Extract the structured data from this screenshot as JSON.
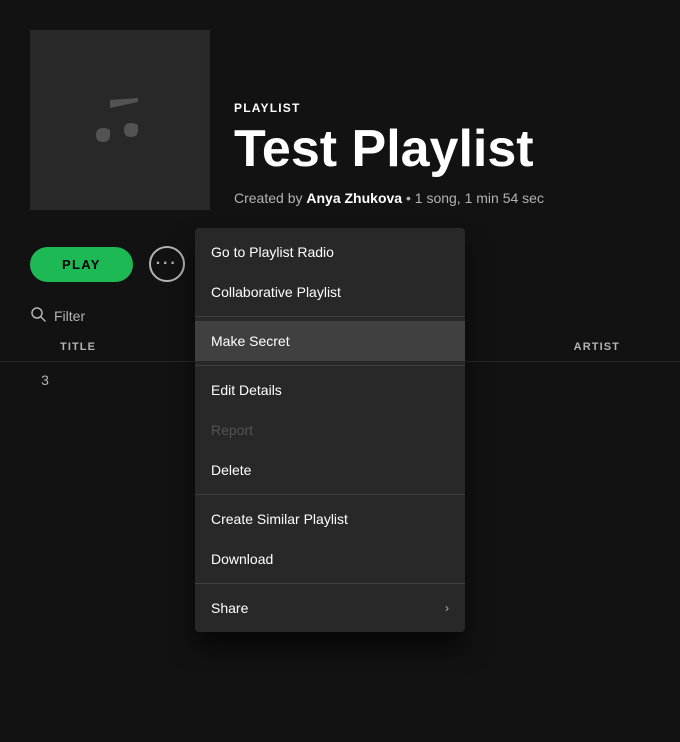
{
  "header": {
    "type_label": "PLAYLIST",
    "title": "Test Playlist",
    "creator": "Anya Zhukova",
    "meta": "1 song, 1 min 54 sec"
  },
  "controls": {
    "play_label": "PLAY",
    "more_dots": "•••"
  },
  "filter": {
    "placeholder": "Filter"
  },
  "table": {
    "col_title": "TITLE",
    "col_artist": "ARTIST",
    "rows": [
      {
        "number": "3"
      }
    ]
  },
  "context_menu": {
    "items": [
      {
        "id": "go-to-radio",
        "label": "Go to Playlist Radio",
        "highlighted": false,
        "disabled": false,
        "has_arrow": false
      },
      {
        "id": "collaborative-playlist",
        "label": "Collaborative Playlist",
        "highlighted": false,
        "disabled": false,
        "has_arrow": false
      },
      {
        "id": "make-secret",
        "label": "Make Secret",
        "highlighted": true,
        "disabled": false,
        "has_arrow": false
      },
      {
        "id": "edit-details",
        "label": "Edit Details",
        "highlighted": false,
        "disabled": false,
        "has_arrow": false
      },
      {
        "id": "report",
        "label": "Report",
        "highlighted": false,
        "disabled": true,
        "has_arrow": false
      },
      {
        "id": "delete",
        "label": "Delete",
        "highlighted": false,
        "disabled": false,
        "has_arrow": false
      },
      {
        "id": "create-similar",
        "label": "Create Similar Playlist",
        "highlighted": false,
        "disabled": false,
        "has_arrow": false
      },
      {
        "id": "download",
        "label": "Download",
        "highlighted": false,
        "disabled": false,
        "has_arrow": false
      },
      {
        "id": "share",
        "label": "Share",
        "highlighted": false,
        "disabled": false,
        "has_arrow": true
      }
    ],
    "dividers_after": [
      "collaborative-playlist",
      "make-secret",
      "delete",
      "download"
    ]
  },
  "colors": {
    "bg": "#121212",
    "card_bg": "#282828",
    "accent_green": "#1db954",
    "text_primary": "#ffffff",
    "text_secondary": "#b3b3b3",
    "highlighted_bg": "#404040"
  },
  "icons": {
    "music_note": "♩",
    "search": "🔍",
    "dots": "···",
    "chevron": "›"
  }
}
